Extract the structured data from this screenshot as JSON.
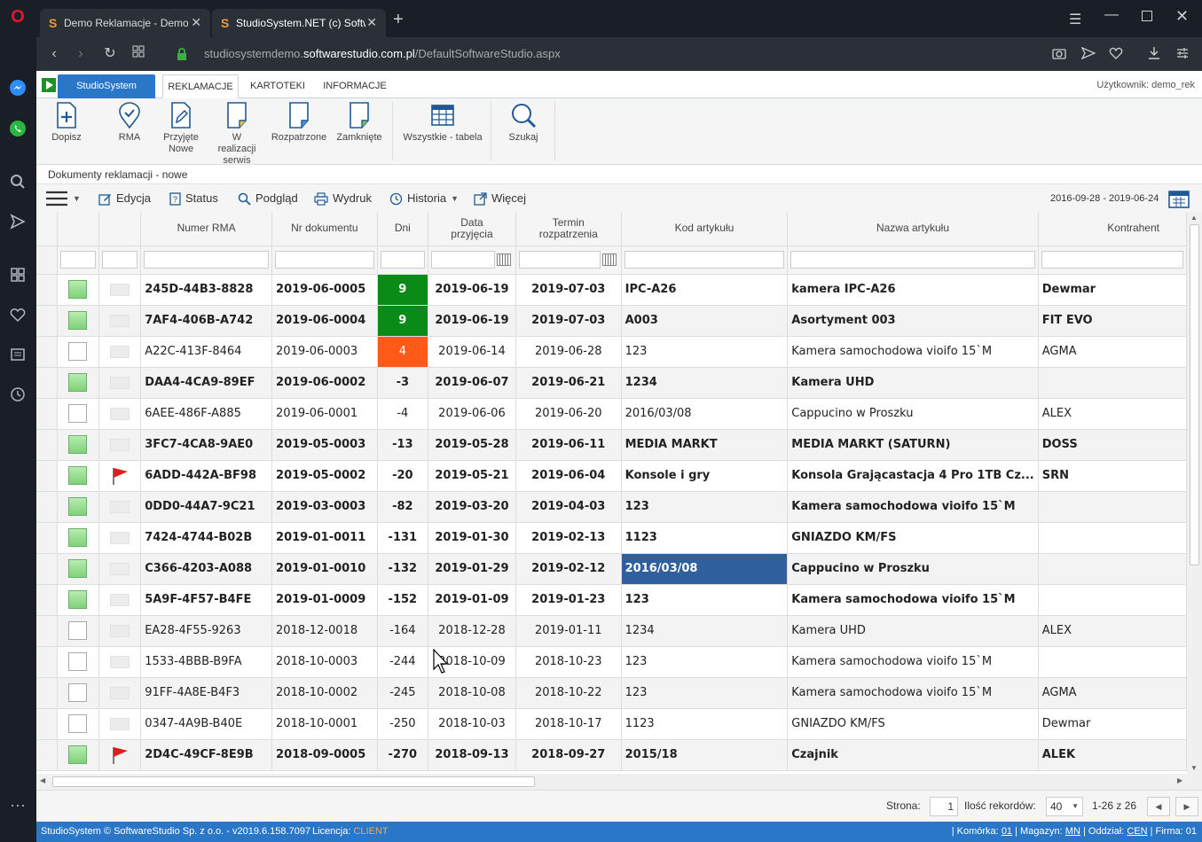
{
  "browser": {
    "tabs": [
      {
        "title": "Demo Reklamacje - Demo",
        "active": false
      },
      {
        "title": "StudioSystem.NET (c) Softw",
        "active": true
      }
    ],
    "new_tab": "+",
    "url_prefix": "studiosystemdemo.",
    "url_domain": "softwarestudio.com.pl",
    "url_path": "/DefaultSoftwareStudio.aspx"
  },
  "app": {
    "app_tab": "StudioSystem",
    "menu": [
      "REKLAMACJE",
      "KARTOTEKI",
      "INFORMACJE"
    ],
    "user": "Użytkownik: demo_rek",
    "ribbon": [
      {
        "label": "Dopisz",
        "icon": "add-document-icon"
      },
      {
        "label": "RMA",
        "icon": "location-check-icon"
      },
      {
        "label": "Przyjęte Nowe",
        "icon": "edit-document-icon"
      },
      {
        "label": "W realizacji serwis",
        "icon": "document-icon"
      },
      {
        "label": "Rozpatrzone",
        "icon": "document-icon"
      },
      {
        "label": "Zamknięte",
        "icon": "document-icon"
      },
      {
        "label": "Wszystkie - tabela",
        "icon": "table-icon"
      },
      {
        "label": "Szukaj",
        "icon": "search-icon"
      }
    ],
    "breadcrumb": "Dokumenty reklamacji - nowe",
    "toolbar": {
      "edit": "Edycja",
      "status": "Status",
      "preview": "Podgląd",
      "print": "Wydruk",
      "history": "Historia",
      "more": "Więcej",
      "date_range": "2016-09-28 - 2019-06-24"
    }
  },
  "grid": {
    "columns": [
      "Numer RMA",
      "Nr dokumentu",
      "Dni",
      "Data przyjęcia",
      "Termin rozpatrzenia",
      "Kod artykułu",
      "Nazwa artykułu",
      "Kontrahent"
    ],
    "rows": [
      {
        "checked": true,
        "flag": false,
        "bold": true,
        "rma": "245D-44B3-8828",
        "doc": "2019-06-0005",
        "days": "9",
        "days_color": "green",
        "date": "2019-06-19",
        "term": "2019-07-03",
        "code": "IPC-A26",
        "name": "kamera IPC-A26",
        "party": "Dewmar"
      },
      {
        "checked": true,
        "flag": false,
        "bold": true,
        "rma": "7AF4-406B-A742",
        "doc": "2019-06-0004",
        "days": "9",
        "days_color": "green",
        "date": "2019-06-19",
        "term": "2019-07-03",
        "code": "A003",
        "name": "Asortyment 003",
        "party": "FIT EVO"
      },
      {
        "checked": false,
        "flag": false,
        "bold": false,
        "rma": "A22C-413F-8464",
        "doc": "2019-06-0003",
        "days": "4",
        "days_color": "orange",
        "date": "2019-06-14",
        "term": "2019-06-28",
        "code": "123",
        "name": "Kamera samochodowa vioifo 15`M",
        "party": "AGMA"
      },
      {
        "checked": true,
        "flag": false,
        "bold": true,
        "rma": "DAA4-4CA9-89EF",
        "doc": "2019-06-0002",
        "days": "-3",
        "days_color": "",
        "date": "2019-06-07",
        "term": "2019-06-21",
        "code": "1234",
        "name": "Kamera UHD",
        "party": ""
      },
      {
        "checked": false,
        "flag": false,
        "bold": false,
        "rma": "6AEE-486F-A885",
        "doc": "2019-06-0001",
        "days": "-4",
        "days_color": "",
        "date": "2019-06-06",
        "term": "2019-06-20",
        "code": "2016/03/08",
        "name": "Cappucino w Proszku",
        "party": "ALEX"
      },
      {
        "checked": true,
        "flag": false,
        "bold": true,
        "rma": "3FC7-4CA8-9AE0",
        "doc": "2019-05-0003",
        "days": "-13",
        "days_color": "",
        "date": "2019-05-28",
        "term": "2019-06-11",
        "code": "MEDIA MARKT",
        "name": "MEDIA MARKT (SATURN)",
        "party": "DOSS"
      },
      {
        "checked": true,
        "flag": true,
        "bold": true,
        "rma": "6ADD-442A-BF98",
        "doc": "2019-05-0002",
        "days": "-20",
        "days_color": "",
        "date": "2019-05-21",
        "term": "2019-06-04",
        "code": "Konsole i gry",
        "name": "Konsola Grającastacja 4 Pro 1TB Cz...",
        "party": "SRN"
      },
      {
        "checked": true,
        "flag": false,
        "bold": true,
        "rma": "0DD0-44A7-9C21",
        "doc": "2019-03-0003",
        "days": "-82",
        "days_color": "",
        "date": "2019-03-20",
        "term": "2019-04-03",
        "code": "123",
        "name": "Kamera samochodowa vioifo 15`M",
        "party": ""
      },
      {
        "checked": true,
        "flag": false,
        "bold": true,
        "rma": "7424-4744-B02B",
        "doc": "2019-01-0011",
        "days": "-131",
        "days_color": "",
        "date": "2019-01-30",
        "term": "2019-02-13",
        "code": "1123",
        "name": "GNIAZDO KM/FS",
        "party": ""
      },
      {
        "checked": true,
        "flag": false,
        "bold": true,
        "rma": "C366-4203-A088",
        "doc": "2019-01-0010",
        "days": "-132",
        "days_color": "",
        "date": "2019-01-29",
        "term": "2019-02-12",
        "code": "2016/03/08",
        "name": "Cappucino w Proszku",
        "party": "",
        "selected_code": true
      },
      {
        "checked": true,
        "flag": false,
        "bold": true,
        "rma": "5A9F-4F57-B4FE",
        "doc": "2019-01-0009",
        "days": "-152",
        "days_color": "",
        "date": "2019-01-09",
        "term": "2019-01-23",
        "code": "123",
        "name": "Kamera samochodowa vioifo 15`M",
        "party": ""
      },
      {
        "checked": false,
        "flag": false,
        "bold": false,
        "rma": "EA28-4F55-9263",
        "doc": "2018-12-0018",
        "days": "-164",
        "days_color": "",
        "date": "2018-12-28",
        "term": "2019-01-11",
        "code": "1234",
        "name": "Kamera UHD",
        "party": "ALEX"
      },
      {
        "checked": false,
        "flag": false,
        "bold": false,
        "rma": "1533-4BBB-B9FA",
        "doc": "2018-10-0003",
        "days": "-244",
        "days_color": "",
        "date": "2018-10-09",
        "term": "2018-10-23",
        "code": "123",
        "name": "Kamera samochodowa vioifo 15`M",
        "party": ""
      },
      {
        "checked": false,
        "flag": false,
        "bold": false,
        "rma": "91FF-4A8E-B4F3",
        "doc": "2018-10-0002",
        "days": "-245",
        "days_color": "",
        "date": "2018-10-08",
        "term": "2018-10-22",
        "code": "123",
        "name": "Kamera samochodowa vioifo 15`M",
        "party": "AGMA"
      },
      {
        "checked": false,
        "flag": false,
        "bold": false,
        "rma": "0347-4A9B-B40E",
        "doc": "2018-10-0001",
        "days": "-250",
        "days_color": "",
        "date": "2018-10-03",
        "term": "2018-10-17",
        "code": "1123",
        "name": "GNIAZDO KM/FS",
        "party": "Dewmar"
      },
      {
        "checked": true,
        "flag": true,
        "bold": true,
        "rma": "2D4C-49CF-8E9B",
        "doc": "2018-09-0005",
        "days": "-270",
        "days_color": "",
        "date": "2018-09-13",
        "term": "2018-09-27",
        "code": "2015/18",
        "name": "Czajnik",
        "party": "ALEK"
      }
    ]
  },
  "pager": {
    "page_label": "Strona:",
    "page": "1",
    "records_label": "Ilość rekordów:",
    "records": "40",
    "range": "1-26 z 26"
  },
  "status": {
    "copyright": "StudioSystem © SoftwareStudio Sp. z o.o. - v2019.6.158.7097",
    "license_label": "Licencja:",
    "license": "CLIENT",
    "cell_label": "| Komórka:",
    "cell": "01",
    "warehouse_label": "| Magazyn:",
    "warehouse": "MN",
    "branch_label": "| Oddział:",
    "branch": "CEN",
    "company_label": "| Firma:",
    "company": "01"
  },
  "colors": {
    "accent": "#2a77c7",
    "positive_days": "#0a8a16",
    "warning_days": "#ff5a19",
    "selection": "#2f5f9c"
  }
}
